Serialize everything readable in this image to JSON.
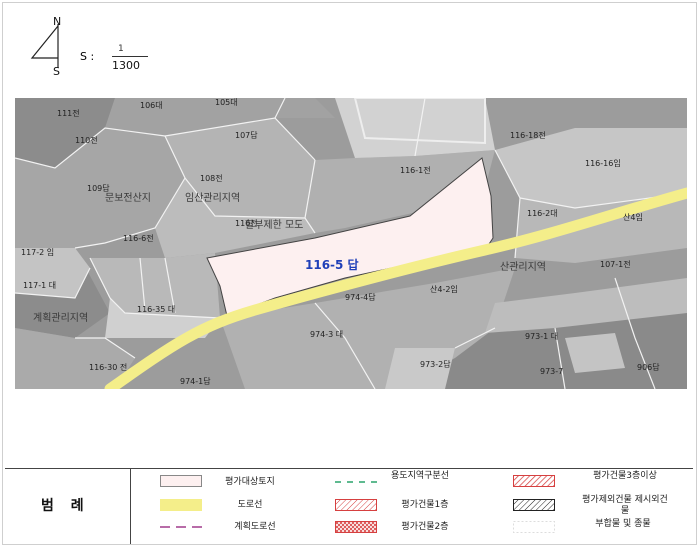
{
  "compass": {
    "north": "N",
    "south": "S"
  },
  "scale": {
    "label": "S :",
    "numerator": "1",
    "denominator": "1300"
  },
  "map": {
    "subject_label": "116-5 답",
    "parcels": [
      "106대",
      "105대",
      "111전",
      "107답",
      "110전",
      "108전",
      "109답",
      "116-1전",
      "116-16임",
      "116-2대",
      "산4임",
      "117-2 임",
      "116-6전",
      "116전",
      "117-1 대",
      "116-35 대",
      "116-30 전",
      "974-4답",
      "산4-2임",
      "974-3 대",
      "973-2답",
      "973-1 대",
      "973-7",
      "906답",
      "107-1전",
      "116-18전",
      "974-1답"
    ],
    "zone_labels": [
      "문보전산지",
      "임산관리지역",
      "할부제한 모도",
      "계획관리지역",
      "산관리지역"
    ]
  },
  "legend": {
    "title": "범 례",
    "items": [
      {
        "label": "평가대상토지"
      },
      {
        "label": "용도지역구분선"
      },
      {
        "label": "평가건물3층이상"
      },
      {
        "label": "도로선"
      },
      {
        "label": "평가건물1층"
      },
      {
        "label": "평가제외건물 제시외건물"
      },
      {
        "label": "계획도로선"
      },
      {
        "label": "평가건물2층"
      },
      {
        "label": "부합물 및 종물"
      }
    ]
  },
  "colors": {
    "subject_fill": "#fdf0f0",
    "road": "#f4ee8a",
    "parcel_dark": "#8f8f8f",
    "parcel_mid": "#a9a9a9",
    "parcel_light": "#cfcfcf",
    "subject_label": "#1f3fb8"
  }
}
